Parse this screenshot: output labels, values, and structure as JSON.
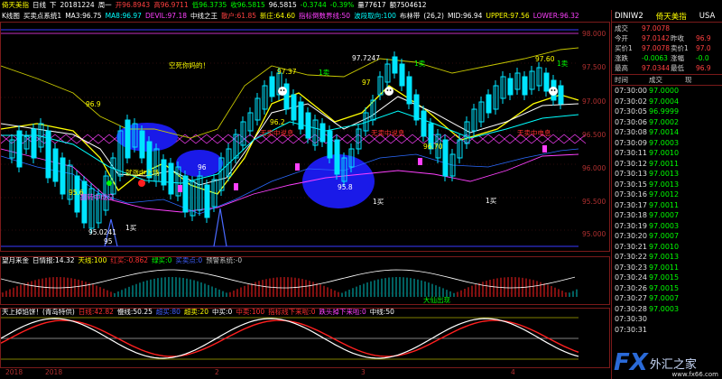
{
  "topbar": {
    "symbol": "倚天美指",
    "period": "日线",
    "arrow": "下",
    "date": "20181224",
    "weekday": "周一",
    "open": "开96.8943",
    "high": "高96.9711",
    "low": "低96.3735",
    "close": "收96.5815",
    "last": "96.5815",
    "change": "-0.3744",
    "pct": "-0.39%",
    "vol": "量77617",
    "amount": "额7504612"
  },
  "indbar": {
    "name": "K线图",
    "sys": "买卖点系统1",
    "ma": "MA3:96.75",
    "ma8": "MA8:96.97",
    "devil": "DEVIL:97.18",
    "zxzw": "中线之王",
    "sanhu": "散户:61.85",
    "xinzhu": "新庄:64.60",
    "zhibiao": "指标倒数界线:50",
    "bodong": "波段取向:100",
    "bull": "布林带",
    "boll": "(26,2)",
    "mid": "MID:96.94",
    "upper": "UPPER:97.56",
    "lower": "LOWER:96.32"
  },
  "sub1bar": {
    "name": "望月来金",
    "v1": "日情报:14.32",
    "v2": "天线:100",
    "v3": "红买:-0.862",
    "v4": "绿买:0",
    "v5": "买卖点:0",
    "v6": "预警系统:-0"
  },
  "sub2bar": {
    "name": "天上掉馅饼！(青岛特供)",
    "v1": "日线:42.82",
    "v2": "慢线:50.25",
    "v3": "超买:80",
    "v4": "超卖:20",
    "v5": "中买:0",
    "v6": "中卖:100",
    "v7": "指标线下来啦:0",
    "v8": "跌头掉下来啦:0",
    "v9": "中线:50"
  },
  "main_labels": {
    "price_high": "97.37",
    "price_high2": "97.7247",
    "price_97": "97",
    "price_969": "96.9",
    "price_962": "96.2",
    "price_9670": "96.70",
    "price_9760": "97.60",
    "price_958": "95.8",
    "price_956": "95.6",
    "price_low": "95.0241",
    "price_95": "95",
    "ellipse_96": "96",
    "buy_text": "就涨中上场",
    "buy_text2": "翻转中成交",
    "mid_sell1": "无卖中说息",
    "mid_sell2": "无卖中说息",
    "mid_sell3": "无卖中电息",
    "top_text": "空死你妈的！",
    "sell1": "1卖",
    "sell2": "1卖",
    "sell3": "1卖",
    "buy1": "1买",
    "buy2": "1买",
    "buy3": "1买",
    "axis_9800": "98.000",
    "axis_9750": "97.500",
    "axis_9700": "97.000",
    "axis_9650": "96.500",
    "axis_9600": "96.000",
    "axis_9550": "95.500",
    "axis_9500": "95.000",
    "sub1_label": "大仙出现"
  },
  "xaxis": {
    "l1": "2018",
    "l2": "2018",
    "l3": "2",
    "l4": "3",
    "l5": "4"
  },
  "sidebar": {
    "symbol": "DINIW2",
    "name": "倚天美指",
    "market": "USA",
    "quotes": [
      [
        "成交",
        "97.0078",
        "",
        ""
      ],
      [
        "今开",
        "97.0142",
        "昨收",
        "96.9"
      ],
      [
        "买价1",
        "97.0078",
        "卖价1",
        "97.0"
      ],
      [
        "涨跌",
        "-0.0063",
        "涨幅",
        "-0.0"
      ],
      [
        "最高",
        "97.0344",
        "最低",
        "96.9"
      ]
    ],
    "tick_head": [
      "时间",
      "成交",
      "现"
    ],
    "ticks": [
      [
        "07:30:00",
        "97.0000"
      ],
      [
        "07:30:02",
        "97.0004"
      ],
      [
        "07:30:05",
        "96.9999"
      ],
      [
        "07:30:06",
        "97.0002"
      ],
      [
        "07:30:08",
        "97.0014"
      ],
      [
        "07:30:09",
        "97.0003"
      ],
      [
        "07:30:11",
        "97.0010"
      ],
      [
        "07:30:12",
        "97.0011"
      ],
      [
        "07:30:13",
        "97.0013"
      ],
      [
        "07:30:15",
        "97.0013"
      ],
      [
        "07:30:16",
        "97.0012"
      ],
      [
        "07:30:17",
        "97.0011"
      ],
      [
        "07:30:18",
        "97.0007"
      ],
      [
        "07:30:19",
        "97.0003"
      ],
      [
        "07:30:20",
        "97.0007"
      ],
      [
        "07:30:21",
        "97.0010"
      ],
      [
        "07:30:22",
        "97.0013"
      ],
      [
        "07:30:23",
        "97.0011"
      ],
      [
        "07:30:24",
        "97.0015"
      ],
      [
        "07:30:26",
        "97.0015"
      ],
      [
        "07:30:27",
        "97.0007"
      ],
      [
        "07:30:28",
        "97.0003"
      ],
      [
        "07:30:30",
        ""
      ],
      [
        "07:30:31",
        ""
      ]
    ]
  },
  "watermark": {
    "fx": "FX",
    "cn": "外汇之家",
    "url": "www.fx66.com"
  },
  "colors": {
    "up": "#00e5ff",
    "down": "#ff00ff",
    "yellow": "#ffff00",
    "green": "#00ff00",
    "red": "#ff2020",
    "border": "#7a1a1a"
  }
}
